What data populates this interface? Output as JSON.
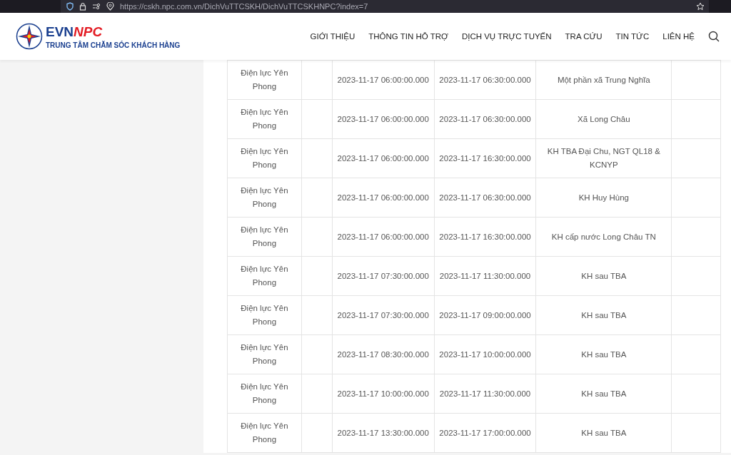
{
  "browser": {
    "url": "https://cskh.npc.com.vn/DichVuTTCSKH/DichVuTTCSKHNPC?index=7"
  },
  "header": {
    "logo_brand_a": "EVN",
    "logo_brand_b": "NPC",
    "logo_subtitle": "TRUNG TÂM CHĂM SÓC KHÁCH HÀNG",
    "nav": [
      "GIỚI THIỆU",
      "THÔNG TIN HỖ TRỢ",
      "DỊCH VỤ TRỰC TUYẾN",
      "TRA CỨU",
      "TIN TỨC",
      "LIÊN HỆ"
    ]
  },
  "table": {
    "rows": [
      {
        "unit": "Điện lực Yên Phong",
        "start": "2023-11-17 06:00:00.000",
        "end": "2023-11-17 06:30:00.000",
        "area": "Một phần xã Trung Nghĩa"
      },
      {
        "unit": "Điện lực Yên Phong",
        "start": "2023-11-17 06:00:00.000",
        "end": "2023-11-17 06:30:00.000",
        "area": "Xã Long Châu"
      },
      {
        "unit": "Điện lực Yên Phong",
        "start": "2023-11-17 06:00:00.000",
        "end": "2023-11-17 16:30:00.000",
        "area": "KH TBA Đại Chu, NGT QL18 & KCNYP"
      },
      {
        "unit": "Điện lực Yên Phong",
        "start": "2023-11-17 06:00:00.000",
        "end": "2023-11-17 06:30:00.000",
        "area": "KH Huy Hùng"
      },
      {
        "unit": "Điện lực Yên Phong",
        "start": "2023-11-17 06:00:00.000",
        "end": "2023-11-17 16:30:00.000",
        "area": "KH cấp nước Long Châu TN"
      },
      {
        "unit": "Điện lực Yên Phong",
        "start": "2023-11-17 07:30:00.000",
        "end": "2023-11-17 11:30:00.000",
        "area": "KH sau TBA"
      },
      {
        "unit": "Điện lực Yên Phong",
        "start": "2023-11-17 07:30:00.000",
        "end": "2023-11-17 09:00:00.000",
        "area": "KH sau TBA"
      },
      {
        "unit": "Điện lực Yên Phong",
        "start": "2023-11-17 08:30:00.000",
        "end": "2023-11-17 10:00:00.000",
        "area": "KH sau TBA"
      },
      {
        "unit": "Điện lực Yên Phong",
        "start": "2023-11-17 10:00:00.000",
        "end": "2023-11-17 11:30:00.000",
        "area": "KH sau TBA"
      },
      {
        "unit": "Điện lực Yên Phong",
        "start": "2023-11-17 13:30:00.000",
        "end": "2023-11-17 17:00:00.000",
        "area": "KH sau TBA"
      }
    ]
  }
}
